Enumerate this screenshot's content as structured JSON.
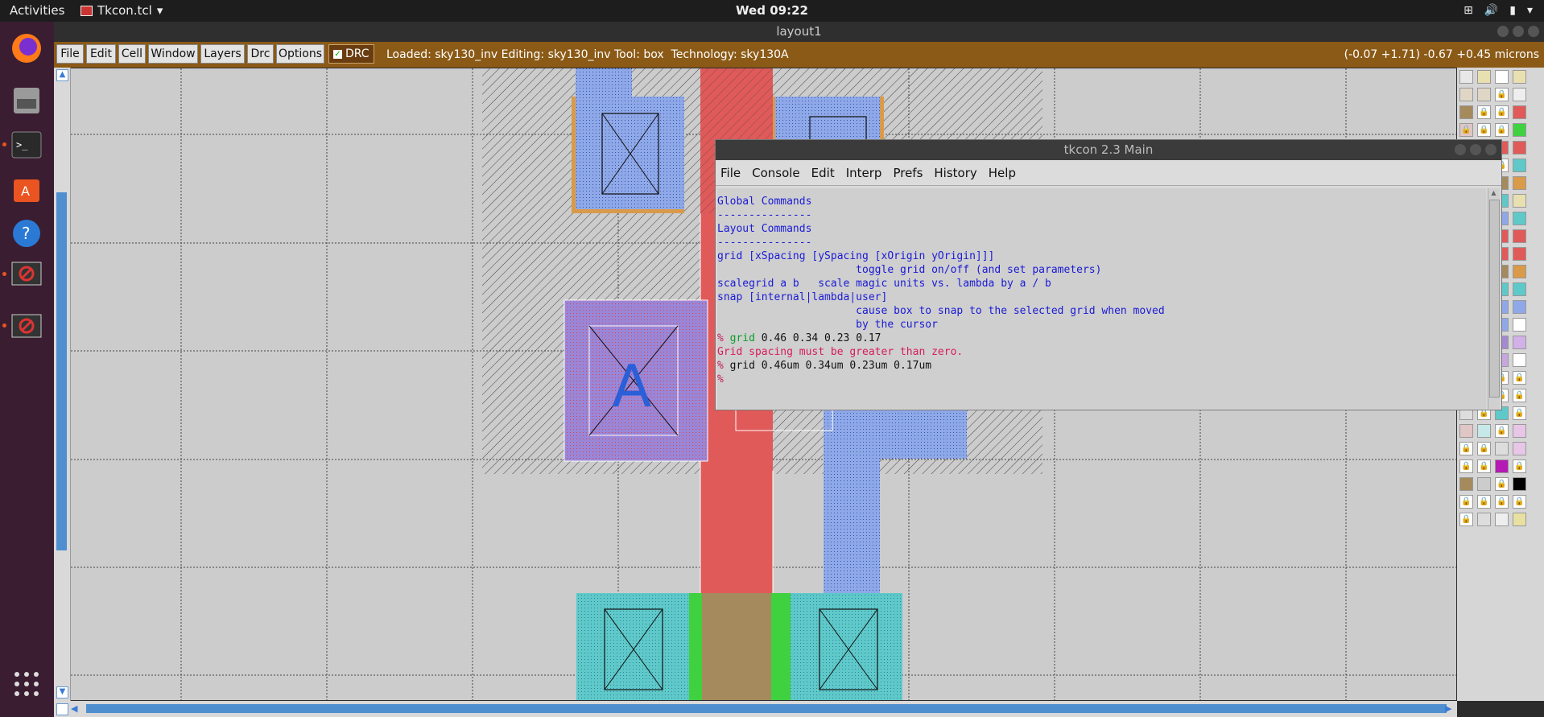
{
  "topbar": {
    "activities": "Activities",
    "app_name": "Tkcon.tcl",
    "clock": "Wed 09:22"
  },
  "window": {
    "title": "layout1"
  },
  "magic_menu": {
    "items": [
      "File",
      "Edit",
      "Cell",
      "Window",
      "Layers",
      "Drc",
      "Options"
    ],
    "drc_label": "DRC",
    "status": "Loaded: sky130_inv Editing: sky130_inv Tool: box  Technology: sky130A",
    "coords": "(-0.07 +1.71) -0.67 +0.45 microns"
  },
  "layout": {
    "label_text": "A"
  },
  "tkcon": {
    "title": "tkcon 2.3 Main",
    "menu": [
      "File",
      "Console",
      "Edit",
      "Interp",
      "Prefs",
      "History",
      "Help"
    ],
    "lines": {
      "l0": "",
      "l1": "Global Commands",
      "l2": "---------------",
      "l3": "",
      "l4": "Layout Commands",
      "l5": "---------------",
      "l6": "grid [xSpacing [ySpacing [xOrigin yOrigin]]]",
      "l7": "                      toggle grid on/off (and set parameters)",
      "l8": "scalegrid a b   scale magic units vs. lambda by a / b",
      "l9": "snap [internal|lambda|user]",
      "l10": "                      cause box to snap to the selected grid when moved",
      "l11": "                      by the cursor"
    },
    "prompt": "%",
    "cmd1": "grid",
    "cmd1_args": " 0.46 0.34 0.23 0.17",
    "error": "Grid spacing must be greater than zero.",
    "cmd2": " grid 0.46um 0.34um 0.23um 0.17um"
  },
  "colors": {
    "poly": "#e05a5a",
    "metal1": "#8fa8e8",
    "nwell_hatch": "#333333",
    "diffusion": "#5fc9c9",
    "contact_green": "#3fd13f",
    "menu_brown": "#8b5a16"
  }
}
